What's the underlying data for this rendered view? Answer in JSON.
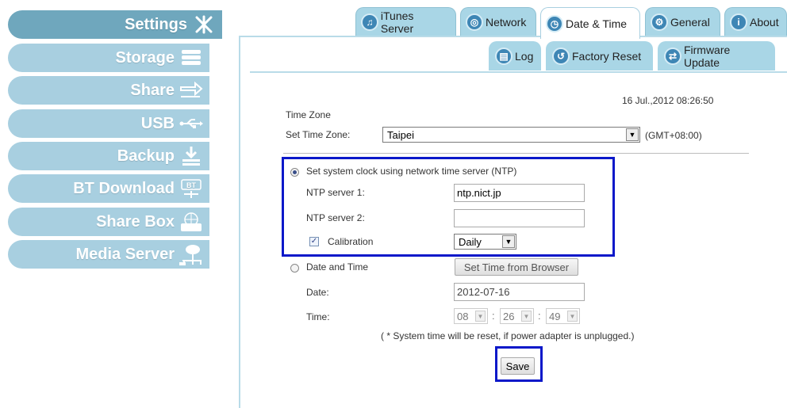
{
  "sidebar": {
    "items": [
      {
        "label": "Settings",
        "icon": "wrench-cross-icon"
      },
      {
        "label": "Storage",
        "icon": "storage-icon"
      },
      {
        "label": "Share",
        "icon": "share-arrows-icon"
      },
      {
        "label": "USB",
        "icon": "usb-icon"
      },
      {
        "label": "Backup",
        "icon": "backup-icon"
      },
      {
        "label": "BT Download",
        "icon": "bt-icon"
      },
      {
        "label": "Share Box",
        "icon": "share-box-icon"
      },
      {
        "label": "Media Server",
        "icon": "media-server-icon"
      }
    ]
  },
  "tabs": [
    {
      "label": "iTunes Server",
      "icon": "music-note-icon"
    },
    {
      "label": "Network",
      "icon": "network-icon"
    },
    {
      "label": "Date & Time",
      "icon": "clock-icon"
    },
    {
      "label": "General",
      "icon": "gears-icon"
    },
    {
      "label": "About",
      "icon": "info-icon"
    }
  ],
  "subtabs": [
    {
      "label": "Log",
      "icon": "book-icon"
    },
    {
      "label": "Factory Reset",
      "icon": "reset-icon"
    },
    {
      "label": "Firmware Update",
      "icon": "update-icon"
    }
  ],
  "content": {
    "current_datetime": "16 Jul.,2012 08:26:50",
    "time_zone_heading": "Time Zone",
    "set_time_zone_label": "Set Time Zone:",
    "time_zone_value": "Taipei",
    "gmt_offset": "(GMT+08:00)",
    "ntp_option_label": "Set system clock using network time server (NTP)",
    "ntp1_label": "NTP server 1:",
    "ntp1_value": "ntp.nict.jp",
    "ntp2_label": "NTP server 2:",
    "ntp2_value": "",
    "calibration_label": "Calibration",
    "calibration_value": "Daily",
    "manual_option_label": "Date and Time",
    "set_from_browser_label": "Set Time from Browser",
    "date_label": "Date:",
    "date_value": "2012-07-16",
    "time_label": "Time:",
    "time_hour": "08",
    "time_minute": "26",
    "time_second": "49",
    "time_separator": ":",
    "note": "( * System time will be reset, if power adapter is unplugged.)",
    "save_label": "Save"
  },
  "colors": {
    "sidebar_active": "#6fa7bd",
    "sidebar_item": "#a8cfe0",
    "tab_bg": "#a9d6e6",
    "highlight_box": "#0b18c9"
  }
}
